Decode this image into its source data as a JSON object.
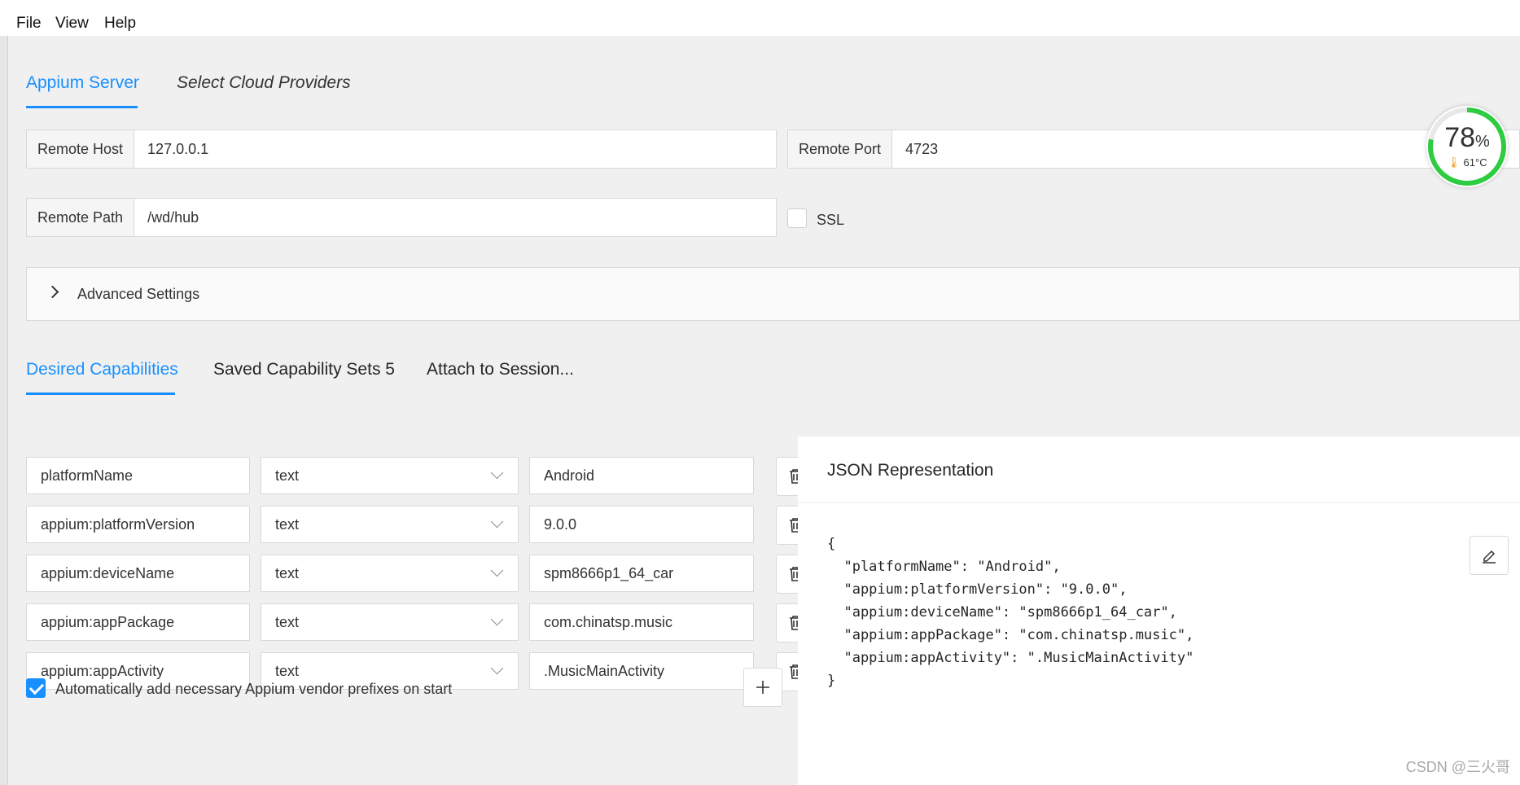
{
  "menu": {
    "file": "File",
    "view": "View",
    "help": "Help"
  },
  "server_tabs": {
    "appium_server": "Appium Server",
    "cloud": "Select Cloud Providers"
  },
  "server": {
    "remote_host_label": "Remote Host",
    "remote_host_value": "127.0.0.1",
    "remote_port_label": "Remote Port",
    "remote_port_value": "4723",
    "remote_path_label": "Remote Path",
    "remote_path_value": "/wd/hub",
    "ssl_label": "SSL",
    "ssl_checked": false
  },
  "advanced": {
    "label": "Advanced Settings"
  },
  "cap_tabs": {
    "desired": "Desired Capabilities",
    "saved": "Saved Capability Sets 5",
    "attach": "Attach to Session..."
  },
  "capabilities": [
    {
      "name": "platformName",
      "type": "text",
      "value": "Android"
    },
    {
      "name": "appium:platformVersion",
      "type": "text",
      "value": "9.0.0"
    },
    {
      "name": "appium:deviceName",
      "type": "text",
      "value": "spm8666p1_64_car"
    },
    {
      "name": "appium:appPackage",
      "type": "text",
      "value": "com.chinatsp.music"
    },
    {
      "name": "appium:appActivity",
      "type": "text",
      "value": ".MusicMainActivity"
    }
  ],
  "auto_prefix": {
    "label": "Automatically add necessary Appium vendor prefixes on start",
    "checked": true
  },
  "json_panel": {
    "title": "JSON Representation",
    "code": "{\n  \"platformName\": \"Android\",\n  \"appium:platformVersion\": \"9.0.0\",\n  \"appium:deviceName\": \"spm8666p1_64_car\",\n  \"appium:appPackage\": \"com.chinatsp.music\",\n  \"appium:appActivity\": \".MusicMainActivity\"\n}"
  },
  "gauge": {
    "percent": "78",
    "percent_unit": "%",
    "temperature": "61°C",
    "level": 0.78
  },
  "watermark": "CSDN @三火哥",
  "colors": {
    "accent": "#1890ff",
    "gauge_ring": "#2ecc40"
  }
}
